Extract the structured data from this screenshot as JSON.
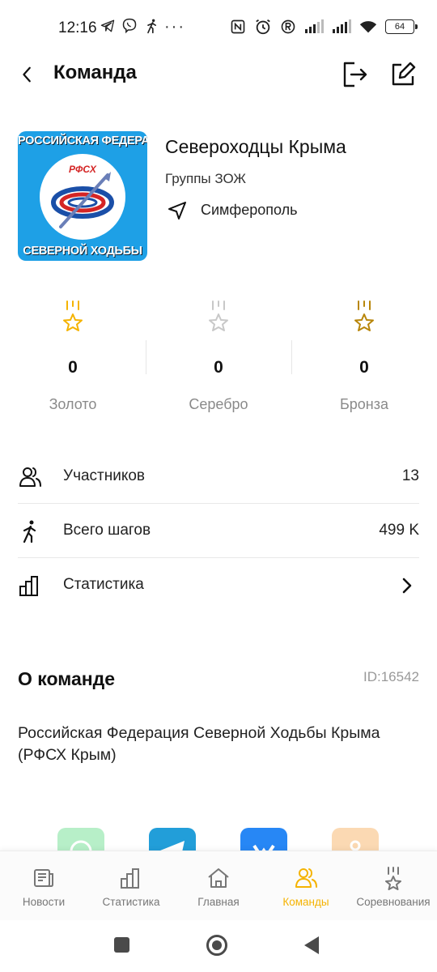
{
  "status_bar": {
    "time": "12:16",
    "dots": "···",
    "battery": "64"
  },
  "header": {
    "title": "Команда",
    "back_icon": "chevron-left-icon",
    "exit_icon": "exit-icon",
    "edit_icon": "edit-icon"
  },
  "team": {
    "logo_text_top": "РОССИЙСКАЯ ФЕДЕРАЦИЯ",
    "logo_text_bottom": "СЕВЕРНОЙ ХОДЬБЫ",
    "logo_abbr": "РФСХ",
    "name": "Североходцы Крыма",
    "type": "Группы ЗОЖ",
    "city": "Симферополь"
  },
  "medals": [
    {
      "count": "0",
      "label": "Золото",
      "color": "#f5b301"
    },
    {
      "count": "0",
      "label": "Серебро",
      "color": "#c8c8c8"
    },
    {
      "count": "0",
      "label": "Бронза",
      "color": "#b8860b"
    }
  ],
  "info": {
    "members_label": "Участников",
    "members_value": "13",
    "steps_label": "Всего шагов",
    "steps_value": "499 K",
    "stats_label": "Статистика"
  },
  "about": {
    "title": "О команде",
    "id": "ID:16542",
    "text": "Российская Федерация Северной Ходьбы Крыма (РФСХ Крым)"
  },
  "social_colors": [
    "#25d366",
    "#229ed9",
    "#2787f5",
    "#f7a440"
  ],
  "nav": {
    "items": [
      {
        "label": "Новости",
        "icon": "news-icon"
      },
      {
        "label": "Статистика",
        "icon": "stats-icon"
      },
      {
        "label": "Главная",
        "icon": "home-icon"
      },
      {
        "label": "Команды",
        "icon": "team-icon"
      },
      {
        "label": "Соревнования",
        "icon": "trophy-icon"
      }
    ],
    "active": "Команды",
    "active_color": "#f5b301"
  }
}
